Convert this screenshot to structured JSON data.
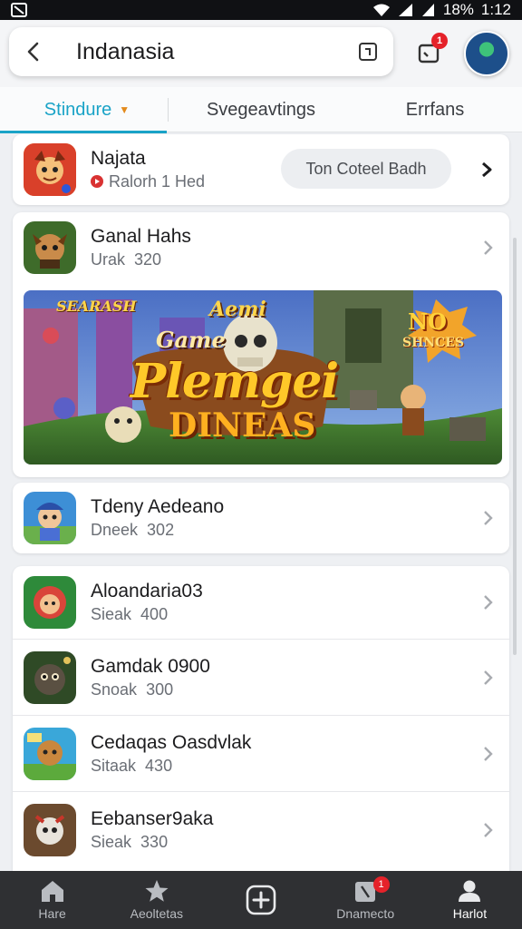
{
  "status_bar": {
    "battery": "18%",
    "time": "1:12"
  },
  "header": {
    "title": "Indanasia",
    "notification_count": "1"
  },
  "tabs": [
    {
      "label": "Stindure",
      "active": true
    },
    {
      "label": "Svegeavtings",
      "active": false
    },
    {
      "label": "Errfans",
      "active": false
    }
  ],
  "featured": {
    "name": "Najata",
    "sub": "Ralorh 1 Hed",
    "action": "Ton Coteel Badh"
  },
  "banner": {
    "top_left": "SEARASH",
    "aemi": "Aemi",
    "game": "Game",
    "title": "Plemgei",
    "subtitle": "DINEAS",
    "corner_title": "NO",
    "corner_sub": "SHNCES"
  },
  "apps": [
    {
      "name": "Ganal Hahs",
      "sub": "Urak",
      "value": "320"
    },
    {
      "name": "Tdeny Aedeano",
      "sub": "Dneek",
      "value": "302"
    },
    {
      "name": "Aloandaria03",
      "sub": "Sieak",
      "value": "400"
    },
    {
      "name": "Gamdak 0900",
      "sub": "Snoak",
      "value": "300"
    },
    {
      "name": "Cedaqas Oasdvlak",
      "sub": "Sitaak",
      "value": "430"
    },
    {
      "name": "Eebanser9aka",
      "sub": "Sieak",
      "value": "330"
    }
  ],
  "bottom_nav": [
    {
      "label": "Hare",
      "icon": "home-icon"
    },
    {
      "label": "Aeoltetas",
      "icon": "star-icon"
    },
    {
      "label": "",
      "icon": "add-icon"
    },
    {
      "label": "Dnamecto",
      "icon": "inbox-icon",
      "badge": "1"
    },
    {
      "label": "Harlot",
      "icon": "profile-icon"
    }
  ],
  "colors": {
    "accent": "#1aa3c7",
    "badge": "#e5222a",
    "nav_bg": "#2f3033"
  }
}
